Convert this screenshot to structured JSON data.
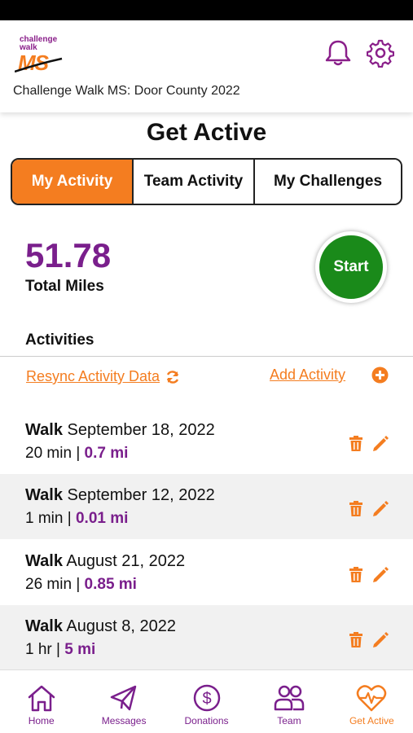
{
  "app": {
    "logo_line1": "challenge",
    "logo_line2": "walk",
    "logo_ms": "MS",
    "event_title": "Challenge Walk MS: Door County 2022",
    "bell_icon": "bell-icon",
    "settings_icon": "gear-icon"
  },
  "page": {
    "title": "Get Active"
  },
  "tabs": [
    {
      "label": "My Activity",
      "active": true
    },
    {
      "label": "Team Activity",
      "active": false
    },
    {
      "label": "My Challenges",
      "active": false
    }
  ],
  "summary": {
    "total_miles": "51.78",
    "total_label": "Total Miles",
    "start_label": "Start"
  },
  "activities": {
    "heading": "Activities",
    "resync_label": "Resync Activity Data",
    "add_label": "Add Activity",
    "items": [
      {
        "type": "Walk",
        "date": "September 18, 2022",
        "duration": "20 min",
        "separator": "|",
        "distance": "0.7 mi"
      },
      {
        "type": "Walk",
        "date": "September 12, 2022",
        "duration": "1 min",
        "separator": "|",
        "distance": "0.01 mi"
      },
      {
        "type": "Walk",
        "date": "August 21, 2022",
        "duration": "26 min",
        "separator": "|",
        "distance": "0.85 mi"
      },
      {
        "type": "Walk",
        "date": "August 8, 2022",
        "duration": "1 hr",
        "separator": "|",
        "distance": "5 mi"
      }
    ]
  },
  "nav": [
    {
      "label": "Home",
      "icon": "home-icon",
      "active": false
    },
    {
      "label": "Messages",
      "icon": "send-icon",
      "active": false
    },
    {
      "label": "Donations",
      "icon": "dollar-icon",
      "active": false
    },
    {
      "label": "Team",
      "icon": "team-icon",
      "active": false
    },
    {
      "label": "Get Active",
      "icon": "heart-pulse-icon",
      "active": true
    }
  ],
  "colors": {
    "orange": "#f47d20",
    "purple": "#7a1f8c",
    "green": "#1a8a1a"
  }
}
